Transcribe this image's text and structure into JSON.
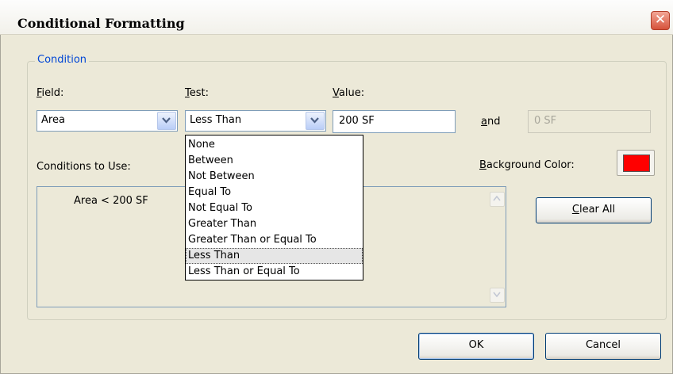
{
  "window": {
    "title": "Conditional Formatting",
    "close_glyph": "✕"
  },
  "group": {
    "legend": "Condition"
  },
  "field": {
    "label": "Field:",
    "selected": "Area"
  },
  "test": {
    "label": "Test:",
    "selected": "Less Than",
    "options": [
      "None",
      "Between",
      "Not Between",
      "Equal To",
      "Not Equal To",
      "Greater Than",
      "Greater Than or Equal To",
      "Less Than",
      "Less Than or Equal To"
    ],
    "highlighted_index": 7
  },
  "value": {
    "label": "Value:",
    "value": "200 SF"
  },
  "and_value": {
    "label": "and",
    "value": "0 SF"
  },
  "conditions": {
    "label": "Conditions to Use:",
    "items": [
      "Area < 200 SF"
    ]
  },
  "background_color": {
    "label": "Background Color:",
    "color": "#ff0000"
  },
  "buttons": {
    "clear_all": "Clear All",
    "ok": "OK",
    "cancel": "Cancel"
  },
  "icons": {
    "dropdown": "chevron-down-icon",
    "scroll_up": "scroll-up-arrow-icon",
    "scroll_down": "scroll-down-arrow-icon",
    "close": "close-icon"
  }
}
